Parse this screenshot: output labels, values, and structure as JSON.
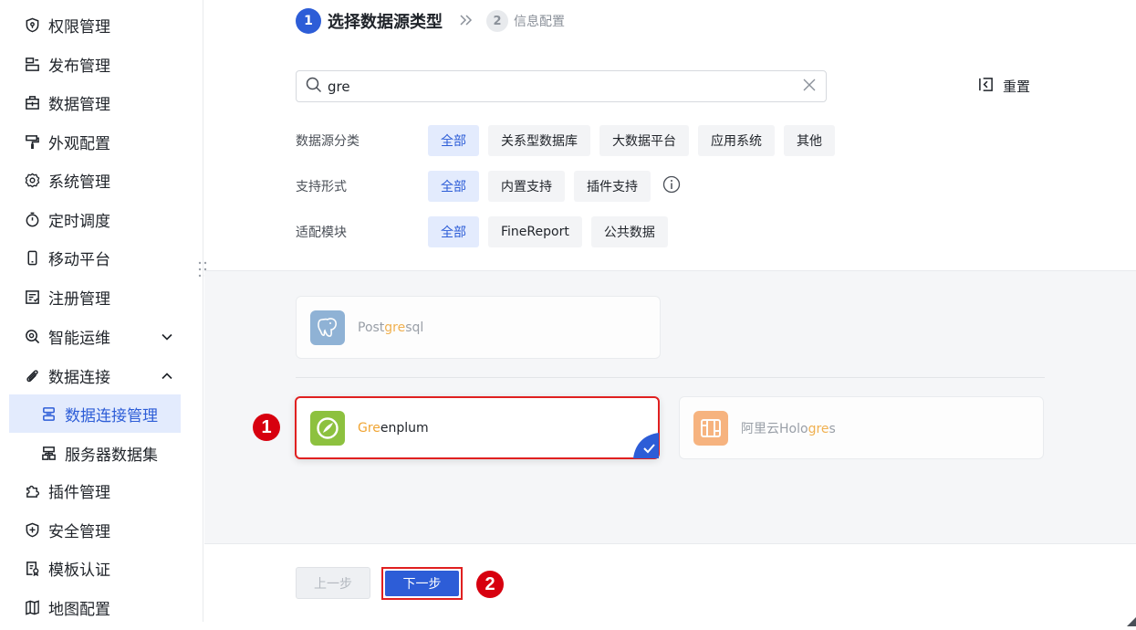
{
  "sidebar": {
    "items": [
      {
        "label": "权限管理",
        "icon": "shield-lock-icon"
      },
      {
        "label": "发布管理",
        "icon": "publish-icon"
      },
      {
        "label": "数据管理",
        "icon": "briefcase-icon"
      },
      {
        "label": "外观配置",
        "icon": "paint-roller-icon"
      },
      {
        "label": "系统管理",
        "icon": "gear-icon"
      },
      {
        "label": "定时调度",
        "icon": "stopwatch-icon"
      },
      {
        "label": "移动平台",
        "icon": "mobile-icon"
      },
      {
        "label": "注册管理",
        "icon": "register-icon"
      },
      {
        "label": "智能运维",
        "icon": "ops-icon",
        "expand": "collapsed"
      },
      {
        "label": "数据连接",
        "icon": "paperclip-icon",
        "expand": "expanded"
      },
      {
        "label": "数据连接管理",
        "icon": "db-connection-icon",
        "active": true
      },
      {
        "label": "服务器数据集",
        "icon": "server-dataset-icon"
      },
      {
        "label": "插件管理",
        "icon": "puzzle-icon"
      },
      {
        "label": "安全管理",
        "icon": "shield-plus-icon"
      },
      {
        "label": "模板认证",
        "icon": "template-cert-icon"
      },
      {
        "label": "地图配置",
        "icon": "map-icon"
      }
    ]
  },
  "steps": [
    {
      "num": "1",
      "label": "选择数据源类型"
    },
    {
      "num": "2",
      "label": "信息配置"
    }
  ],
  "search": {
    "value": "gre",
    "placeholder": ""
  },
  "reset_label": "重置",
  "filters": {
    "category": {
      "label": "数据源分类",
      "options": [
        "全部",
        "关系型数据库",
        "大数据平台",
        "应用系统",
        "其他"
      ],
      "selected": "全部"
    },
    "support": {
      "label": "支持形式",
      "options": [
        "全部",
        "内置支持",
        "插件支持"
      ],
      "selected": "全部"
    },
    "module": {
      "label": "适配模块",
      "options": [
        "全部",
        "FineReport",
        "公共数据"
      ],
      "selected": "全部"
    }
  },
  "results": [
    {
      "prefix": "Post",
      "match": "gre",
      "suffix": "sql",
      "logo_color": "#7ea7cf",
      "icon": "postgresql-elephant-icon"
    },
    {
      "prefix": "",
      "match": "Gre",
      "suffix": "enplum",
      "logo_color": "#8dc13f",
      "icon": "greenplum-icon",
      "selected": true
    },
    {
      "prefix": "阿里云Holo",
      "match": "gre",
      "suffix": "s",
      "logo_color": "#f7a86a",
      "icon": "hologres-icon"
    }
  ],
  "annotations": {
    "badge1": "1",
    "badge2": "2"
  },
  "buttons": {
    "prev": "上一步",
    "next": "下一步"
  },
  "colors": {
    "accent": "#2d5dd7",
    "highlight": "#f0a534",
    "annotation_red": "#e02020"
  }
}
